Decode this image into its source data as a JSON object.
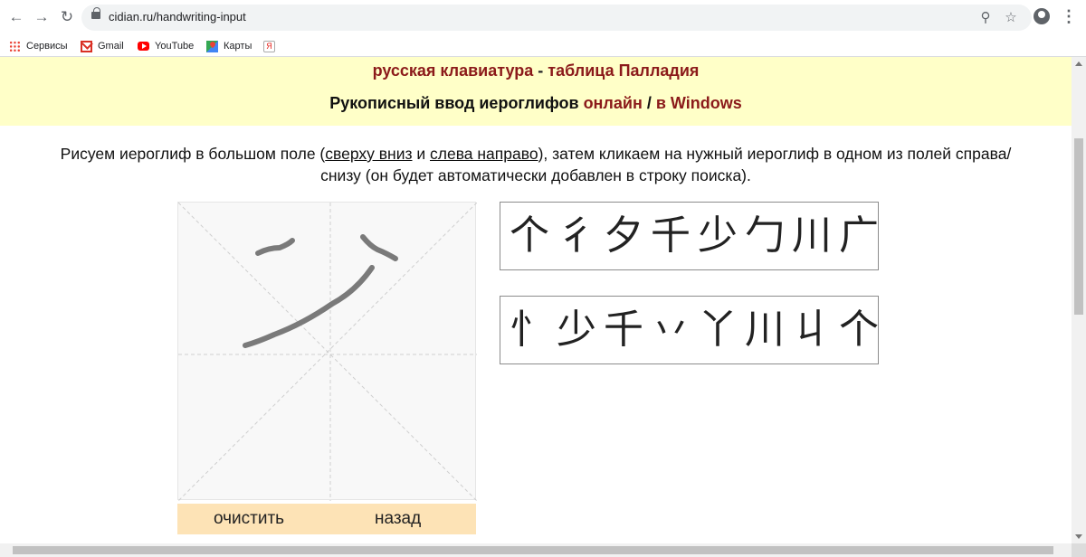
{
  "browser": {
    "url": "cidian.ru/handwriting-input",
    "back_icon": "←",
    "forward_icon": "→",
    "reload_icon": "↻",
    "zoom_icon": "⚲",
    "star_icon": "☆",
    "menu_icon": "⋮",
    "bookmarks": [
      {
        "label": "Сервисы",
        "icon": "apps-icon"
      },
      {
        "label": "Gmail",
        "icon": "gmail-icon"
      },
      {
        "label": "YouTube",
        "icon": "youtube-icon"
      },
      {
        "label": "Карты",
        "icon": "maps-icon"
      },
      {
        "label": "",
        "icon": "yandex-icon",
        "glyph": "Я"
      }
    ]
  },
  "banner": {
    "link_keyboard": "русская клавиатура",
    "separator": " - ",
    "link_palladius": "таблица Палладия",
    "heading": "Рукописный ввод иероглифов ",
    "link_online": "онлайн",
    "slash": " / ",
    "link_windows": "в Windows"
  },
  "intro": {
    "part1": "Рисуем иероглиф в большом поле (",
    "link_top_down": "сверху вниз",
    "part2": " и ",
    "link_left_right": "слева направо",
    "part3": "), затем кликаем на нужный иероглиф в одном из полей справа/",
    "line2": "снизу (он будет автоматически добавлен в строку поиска)."
  },
  "buttons": {
    "clear": "очистить",
    "back": "назад"
  },
  "candidates_1": [
    "个",
    "彳",
    "夕",
    "千",
    "少",
    "勹",
    "川",
    "广"
  ],
  "candidates_2": [
    "忄",
    "少",
    "千",
    "丷",
    "丫",
    "川",
    "丩",
    "个"
  ],
  "colors": {
    "banner_bg": "#ffffc8",
    "link_color": "#8b1a1a",
    "button_bar_bg": "#fde3b6",
    "stroke_color": "#7a7a7a"
  }
}
